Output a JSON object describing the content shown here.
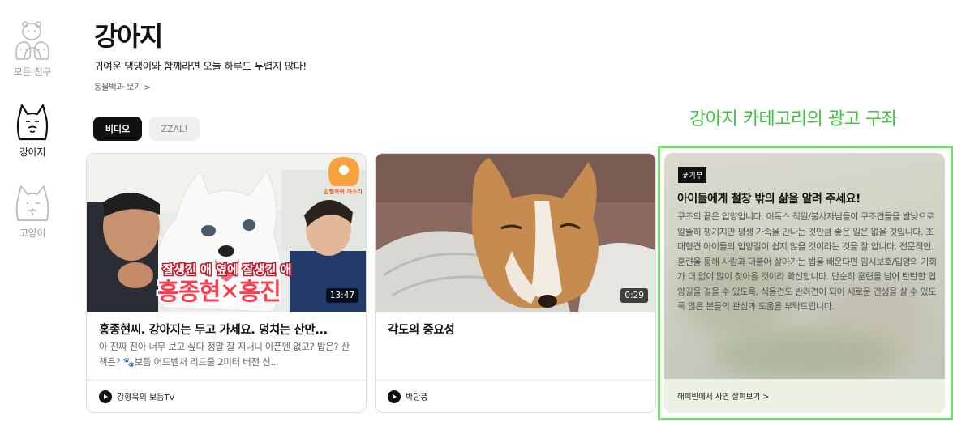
{
  "sidebar": {
    "items": [
      {
        "label": "모든 친구",
        "icon": "bears-group-icon",
        "active": false
      },
      {
        "label": "강아지",
        "icon": "dog-face-icon",
        "active": true
      },
      {
        "label": "고양이",
        "icon": "cat-face-icon",
        "active": false
      }
    ]
  },
  "header": {
    "title": "강아지",
    "subtitle": "귀여운 댕댕이와 함께라면 오늘 하루도 두렵지 않다!",
    "album_link": "동물백과 보기 >"
  },
  "tabs": [
    {
      "label": "비디오",
      "selected": true
    },
    {
      "label": "ZZAL!",
      "selected": false
    }
  ],
  "annotation": "강아지 카테고리의 광고 구좌",
  "cards": [
    {
      "title": "홍종현씨. 강아지는 두고 가세요. 덩치는 산만...",
      "description": "아 진짜 진아 너무 보고 싶다 정말 잘 지내니 아픈덴 없고? 밥은? 산책은? 🐾보듬 어드벤처 리드줄 2미터 버전 신...",
      "duration": "13:47",
      "channel": "강형욱의 보듬TV",
      "thumbnail_caption_top": "잘생긴 애 옆에 잘생긴 애",
      "thumbnail_caption_main": "홍종현✕홍진",
      "thumbnail_logo": "강형욱의 개소리"
    },
    {
      "title": "각도의 중요성",
      "description": "",
      "duration": "0:29",
      "channel": "박단풍"
    }
  ],
  "ad": {
    "tag": "#기부",
    "title": "아이들에게 철창 밖의 삶을 알려 주세요!",
    "body": "구조의 끝은 입양입니다. 어독스 직원/봉사자님들이 구조견들을 밤낮으로 알뜰히 챙기지만 평생 가족을 만나는 것만큼 좋은 일은 없을 것입니다. 초대형견 아이들의 입양길이 쉽지 않을 것이라는 것을 잘 압니다. 전문적인 훈련을 통해 사람과 더불어 살아가는 법을 배운다면 임시보호/입양의 기회가 더 없이 많이 찾아올 것이라 확신합니다. 단순히 훈련을 넘어 탄탄한 입양길을 걸을 수 있도록, 식용견도 반려견이 되어 새로운 견생을 살 수 있도록 많은 분들의 관심과 도움을 부탁드립니다.",
    "footer": "해피빈에서 사연 살펴보기 >"
  },
  "colors": {
    "annotation_green": "#3ec43e",
    "outline_green": "#72e06a",
    "active_tab": "#111111"
  }
}
